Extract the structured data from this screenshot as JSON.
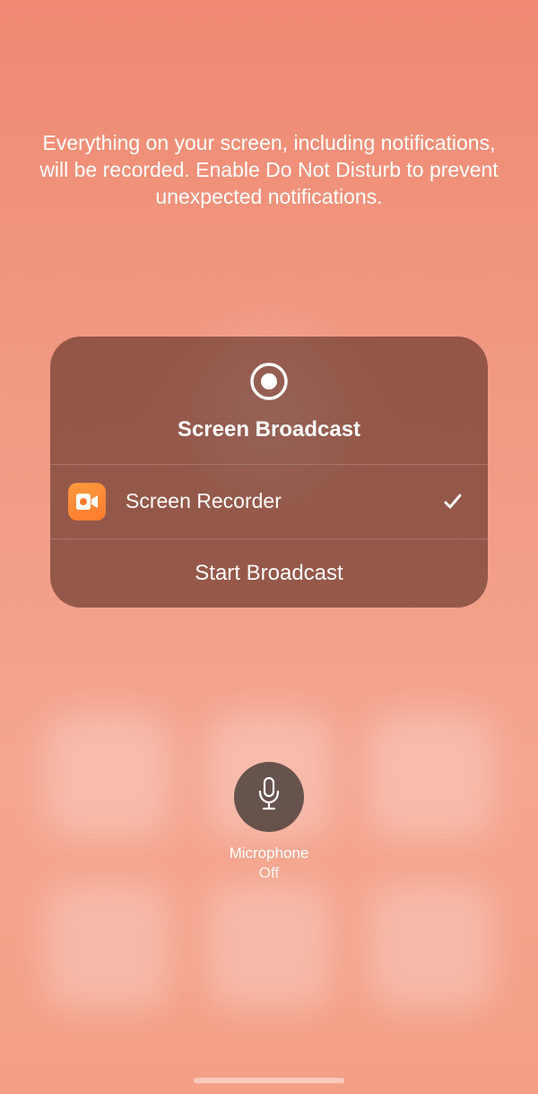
{
  "info_text": "Everything on your screen, including notifications, will be recorded. Enable Do Not Disturb to prevent unexpected notifications.",
  "card": {
    "title": "Screen Broadcast",
    "app": {
      "label": "Screen Recorder"
    },
    "start_label": "Start Broadcast"
  },
  "mic": {
    "label": "Microphone",
    "status": "Off"
  }
}
